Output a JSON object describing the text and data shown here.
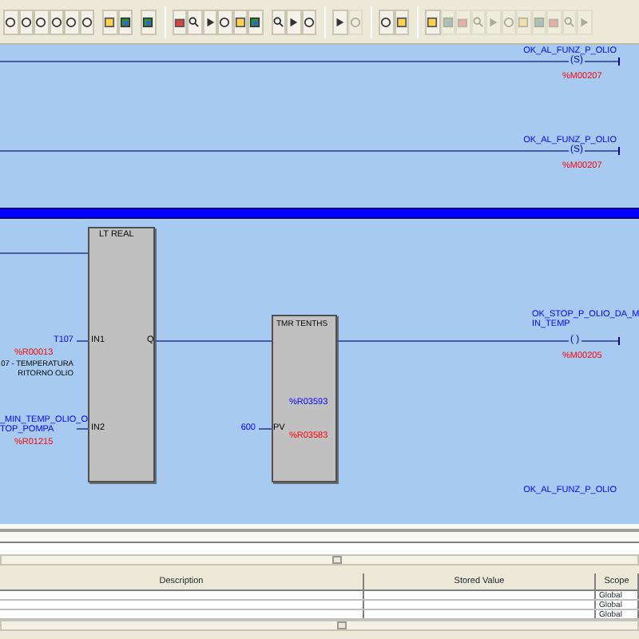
{
  "toolbar_groups": [
    [
      {
        "disabled": false
      },
      {
        "disabled": false
      },
      {
        "disabled": false
      },
      {
        "disabled": false
      },
      {
        "disabled": false
      },
      {
        "disabled": false
      }
    ],
    [
      {
        "disabled": false
      },
      {
        "disabled": false
      }
    ],
    [
      {
        "disabled": false
      }
    ],
    [
      {
        "disabled": false
      },
      {
        "disabled": false
      },
      {
        "disabled": false
      },
      {
        "disabled": false
      },
      {
        "disabled": false
      },
      {
        "disabled": false
      }
    ],
    [
      {
        "disabled": false
      },
      {
        "disabled": false
      },
      {
        "disabled": false
      }
    ],
    [
      {
        "disabled": false
      },
      {
        "disabled": true
      }
    ],
    [
      {
        "disabled": false
      },
      {
        "disabled": false
      }
    ],
    [
      {
        "disabled": false
      },
      {
        "disabled": true
      },
      {
        "disabled": true
      },
      {
        "disabled": true
      },
      {
        "disabled": true
      },
      {
        "disabled": true
      },
      {
        "disabled": true
      },
      {
        "disabled": true
      },
      {
        "disabled": true
      },
      {
        "disabled": true
      },
      {
        "disabled": true
      }
    ]
  ],
  "rungs": [
    {
      "coil_label": [
        "OK_AL_FUNZ_P_OLIO"
      ],
      "coil_symbol": "(S)",
      "address": "%M00207"
    },
    {
      "coil_label": [
        "OK_AL_FUNZ_P_OLIO"
      ],
      "coil_symbol": "(S)",
      "address": "%M00207"
    }
  ],
  "block_rung": {
    "compare_block": {
      "title": "LT REAL",
      "in1_label": "IN1",
      "in2_label": "IN2",
      "out_label": "Q"
    },
    "in1": {
      "operand": "T107",
      "address": "%R00013",
      "description": [
        "07 - TEMPERATURA",
        "RITORNO OLIO"
      ]
    },
    "in2": {
      "operand": [
        "_MIN_TEMP_OLIO_O",
        "TOP_POMPA"
      ],
      "address": "%R01215"
    },
    "timer_block": {
      "title": "TMR TENTHS",
      "register": "%R03593",
      "register_address": "%R03583",
      "pv_label": "PV",
      "pv_value": "600"
    },
    "coil": {
      "label": [
        "OK_STOP_P_OLIO_DA_M",
        "IN_TEMP"
      ],
      "symbol": "( )",
      "address": "%M00205"
    }
  },
  "next_coil_label": "OK_AL_FUNZ_P_OLIO",
  "variables_table": {
    "columns": [
      "Description",
      "Stored Value",
      "Scope"
    ],
    "rows": [
      {
        "scope": "Global"
      },
      {
        "scope": "Global"
      },
      {
        "scope": "Global"
      }
    ]
  }
}
